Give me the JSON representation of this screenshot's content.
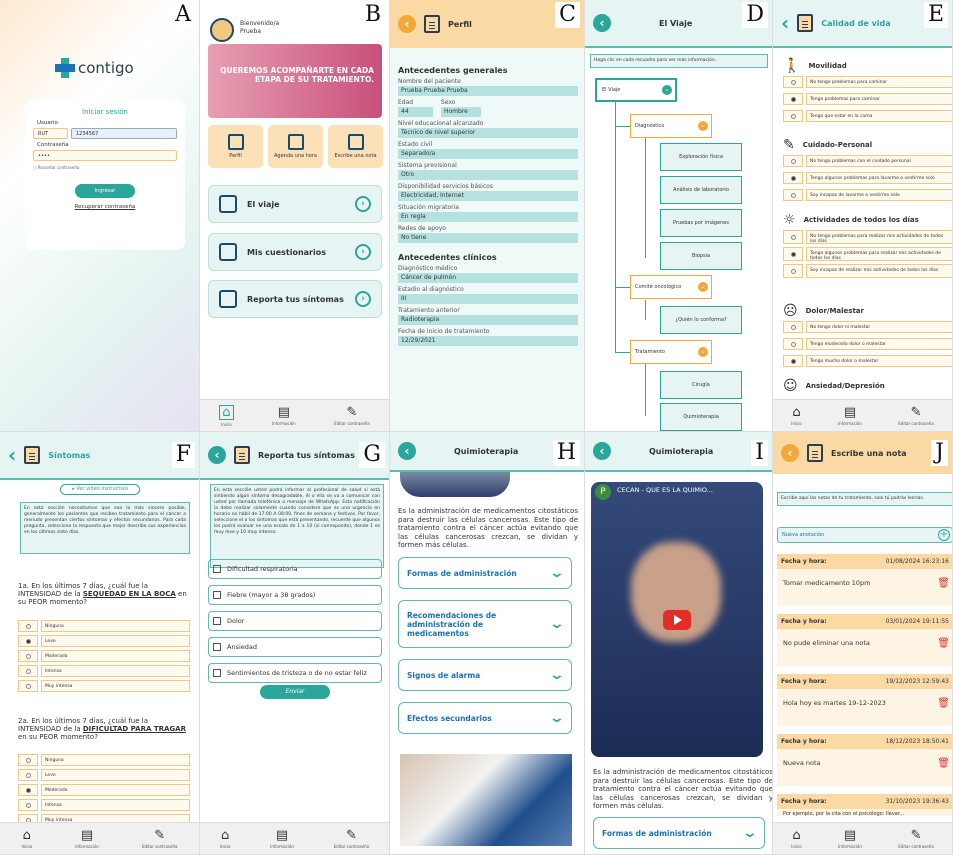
{
  "labels": {
    "A": "A",
    "B": "B",
    "C": "C",
    "D": "D",
    "E": "E",
    "F": "F",
    "G": "G",
    "H": "H",
    "I": "I",
    "J": "J"
  },
  "nav": {
    "home": "Inicio",
    "info": "Información",
    "edit": "Editar contraseña"
  },
  "A": {
    "brand": "contigo",
    "title": "Iniciar sesión",
    "user_label": "Usuario",
    "doc_type": "RUT",
    "user_value": "1234567",
    "pass_label": "Contraseña",
    "pass_value": "••••",
    "remember": "Recordar contraseña",
    "submit": "Ingresar",
    "recover": "Recuperar contraseña"
  },
  "B": {
    "welcome": "Bienvenido/a",
    "name": "Prueba",
    "banner": "QUEREMOS ACOMPAÑARTE EN CADA ETAPA DE SU TRATAMIENTO.",
    "tiles": [
      "Perfil",
      "Agenda una hora",
      "Escribe una nota"
    ],
    "menu": [
      "El viaje",
      "Mis cuestionarios",
      "Reporta tus síntomas"
    ]
  },
  "C": {
    "title": "Perfil",
    "general": "Antecedentes generales",
    "fields": [
      [
        "Nombre del paciente",
        "Prueba Prueba Prueba"
      ],
      [
        "Nivel educacional alcanzado",
        "Técnico de nivel superior"
      ],
      [
        "Estado civil",
        "Separado/a"
      ],
      [
        "Sistema previsional",
        "Otro"
      ],
      [
        "Disponibilidad servicios básicos",
        "Electricidad, Internet"
      ],
      [
        "Situación migratoria",
        "En regla"
      ],
      [
        "Redes de apoyo",
        "No tiene"
      ]
    ],
    "edad_label": "Edad",
    "edad": "44",
    "sexo_label": "Sexo",
    "sexo": "Hombre",
    "clinical": "Antecedentes clínicos",
    "clinical_fields": [
      [
        "Diagnóstico médico",
        "Cáncer de pulmón"
      ],
      [
        "Estadio al diagnóstico",
        "III"
      ],
      [
        "Tratamiento anterior",
        "Radioterapia"
      ],
      [
        "Fecha de inicio de tratamiento",
        "12/29/2021"
      ]
    ]
  },
  "D": {
    "title": "El Viaje",
    "note": "Haga clic en cada recuadro para ver más información.",
    "root": "El Viaje",
    "diag": "Diagnóstico",
    "diag_items": [
      "Exploración física",
      "Análisis de laboratorio",
      "Pruebas por imágenes",
      "Biopsia"
    ],
    "comite": "Comité oncológico",
    "comite_items": [
      "¿Quién lo conforma?"
    ],
    "trat": "Tratamiento",
    "trat_items": [
      "Cirugía",
      "Quimioterapia"
    ]
  },
  "E": {
    "title": "Calidad de vida",
    "groups": [
      {
        "name": "Movilidad",
        "opts": [
          "No tengo problemas para caminar",
          "Tengo problemas para caminar",
          "Tengo que estar en la cama"
        ],
        "sel": 1
      },
      {
        "name": "Cuidado-Personal",
        "opts": [
          "No tengo problemas con el cuidado personal",
          "Tengo algunos problemas para lavarme o vestirme solo",
          "Soy incapaz de lavarme o vestirme solo"
        ],
        "sel": 1
      },
      {
        "name": "Actividades de todos los días",
        "opts": [
          "No tengo problemas para realizar mis actividades de todos los días",
          "Tengo algunos problemas para realizar mis actividades de todos los días",
          "Soy incapaz de realizar mis actividades de todos los días"
        ],
        "sel": 1
      },
      {
        "name": "Dolor/Malestar",
        "opts": [
          "No tengo dolor ni malestar",
          "Tengo moderado dolor o malestar",
          "Tengo mucho dolor o malestar"
        ],
        "sel": 2
      },
      {
        "name": "Ansiedad/Depresión",
        "opts": [],
        "sel": -1
      }
    ]
  },
  "F": {
    "title": "Síntomas",
    "video": "Ver video instructivo",
    "info": "En esta sección necesitamos que sea lo más sincero posible, generalmente los pacientes que reciben tratamiento para el cáncer a menudo presentan ciertos síntomas y efectos secundarios. Para cada pregunta, seleccione la respuesta que mejor describe sus experiencias en los últimos siete días.",
    "q1a": "1a. En los últimos 7 días, ¿cuál fue la INTENSIDAD de la ",
    "q1k": "SEQUEDAD EN LA BOCA",
    "q1b": " en su PEOR momento?",
    "q2a": "2a. En los últimos 7 días, ¿cuál fue la INTENSIDAD de la ",
    "q2k": "DIFICULTAD PARA TRAGAR",
    "q2b": " en su PEOR momento?",
    "opts": [
      "Ninguna",
      "Leve",
      "Moderada",
      "Intensa",
      "Muy intensa"
    ],
    "sel1": 1,
    "sel2": 2
  },
  "G": {
    "title": "Reporta tus síntomas",
    "info": "En esta sección usted podrá informar al profesional de salud si está sintiendo algún síntoma desagradable, él o ella se va a comunicar con usted por llamada telefónica o mensaje de WhatsApp. Esta notificación la debe realizar solamente cuando considere que es una urgencia en horario no hábil de 17:00 A 08:00, fines de semana y festivos. Por favor, seleccione el o los síntomas que está presentando, recuerde que algunos los podrá evaluar en una escala de 1 a 10 (si corresponde), donde 1 es muy leve y 10 muy intenso.",
    "items": [
      "Dificultad respiratoria",
      "Fiebre (mayor a 38 grados)",
      "Dolor",
      "Ansiedad",
      "Sentimientos de tristeza o de no estar feliz"
    ],
    "send": "Enviar"
  },
  "H": {
    "title": "Quimioterapia",
    "para": "Es la administración de medicamentos citostáticos para destruir las células cancerosas. Este tipo de tratamiento contra el cáncer actúa evitando que las células cancerosas crezcan, se dividan y formen más células.",
    "acc": [
      "Formas de administración",
      "Recomendaciones de administración de medicamentos",
      "Signos de alarma",
      "Efectos secundarios"
    ]
  },
  "I": {
    "title": "Quimioterapia",
    "channel": "P",
    "video_title": "CECAN - QUE ES LA QUIMIO...",
    "para": "Es la administración de medicamentos citostáticos para destruir las células cancerosas. Este tipo de tratamiento contra el cáncer actúa evitando que las células cancerosas crezcan, se dividan y formen más células.",
    "acc": "Formas de administración"
  },
  "J": {
    "title": "Escribe una nota",
    "note": "Escribe aquí las notas de tu tratamiento, solo tú podrás leerlas.",
    "new": "Nueva anotación",
    "date_label": "Fecha y hora:",
    "notes": [
      [
        "01/08/2024 16:23:16",
        "Tomar medicamento 10pm"
      ],
      [
        "03/01/2024 19:11:55",
        "No pude eliminar una nota"
      ],
      [
        "19/12/2023 12:59:43",
        "Hola hoy es martes 19-12-2023"
      ],
      [
        "18/12/2023 18:50:41",
        "Nueva nota"
      ],
      [
        "31/10/2023 19:36:43",
        "Por ejemplo, por la cita con el psicólogo: llevar..."
      ]
    ]
  }
}
